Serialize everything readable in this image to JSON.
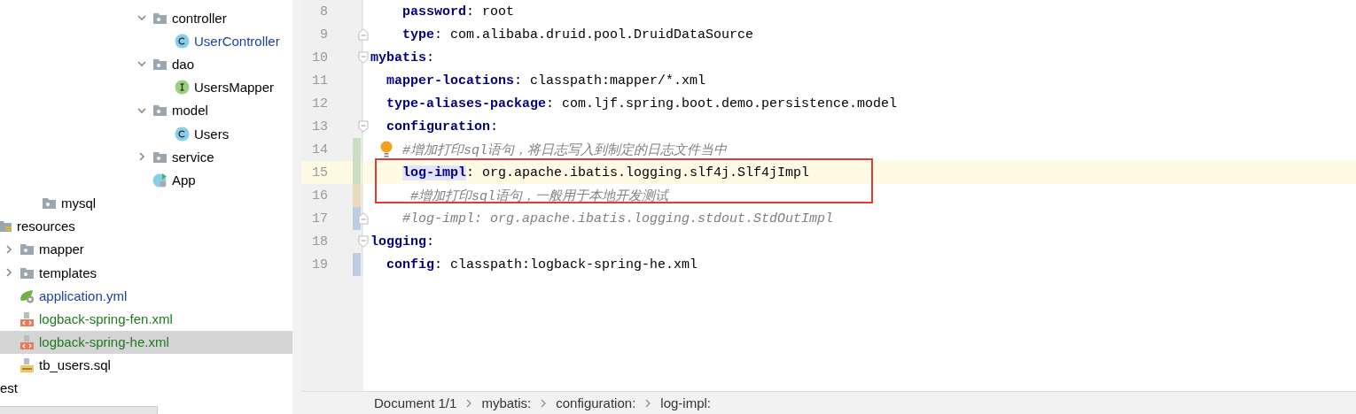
{
  "sidebar": {
    "package_items": [
      {
        "label": "controller",
        "kind": "folder",
        "expanded": true,
        "color": "#000000",
        "selected": false,
        "children": [
          {
            "label": "UserController",
            "kind": "class",
            "color": "#1e3fa8",
            "selected": false
          }
        ]
      },
      {
        "label": "dao",
        "kind": "folder",
        "expanded": true,
        "color": "#000000",
        "selected": false,
        "children": [
          {
            "label": "UsersMapper",
            "kind": "interface",
            "color": "#000000",
            "selected": false
          }
        ]
      },
      {
        "label": "model",
        "kind": "folder",
        "expanded": true,
        "color": "#000000",
        "selected": false,
        "children": [
          {
            "label": "Users",
            "kind": "class",
            "color": "#000000",
            "selected": false
          }
        ]
      },
      {
        "label": "service",
        "kind": "folder",
        "expanded": false,
        "color": "#000000",
        "selected": false
      },
      {
        "label": "App",
        "kind": "app",
        "color": "#000000",
        "selected": false
      }
    ],
    "mysql": {
      "label": "mysql",
      "kind": "folder",
      "color": "#000000",
      "selected": false
    },
    "resources": {
      "label": "resources",
      "kind": "resources",
      "color": "#000000",
      "selected": false,
      "children": [
        {
          "label": "mapper",
          "kind": "folder",
          "expanded": false,
          "color": "#000000",
          "selected": false
        },
        {
          "label": "templates",
          "kind": "folder",
          "expanded": false,
          "color": "#000000",
          "selected": false
        },
        {
          "label": "application.yml",
          "kind": "spring",
          "color": "#1e3fa8",
          "selected": false
        },
        {
          "label": "logback-spring-fen.xml",
          "kind": "xml",
          "color": "#1d7a1d",
          "selected": false
        },
        {
          "label": "logback-spring-he.xml",
          "kind": "xml",
          "color": "#1d7a1d",
          "selected": true
        },
        {
          "label": "tb_users.sql",
          "kind": "sql",
          "color": "#000000",
          "selected": false
        }
      ]
    },
    "test_label": "est"
  },
  "editor": {
    "continued_lines": [
      {
        "number": "8",
        "kind": "pair",
        "key": "password",
        "value": ": root"
      },
      {
        "number": "9",
        "kind": "pair",
        "key": "type",
        "value": ": com.alibaba.druid.pool.DruidDataSource",
        "fold_end": true
      }
    ],
    "lines": [
      {
        "number": "10",
        "kind": "pair",
        "key": "mybatis",
        "value": ":",
        "fold_start": true,
        "children": [
          {
            "number": "11",
            "kind": "pair",
            "key": "mapper-locations",
            "value": ": classpath:mapper/*.xml"
          },
          {
            "number": "12",
            "kind": "pair",
            "key": "type-aliases-package",
            "value": ": com.ljf.spring.boot.demo.persistence.model"
          },
          {
            "number": "13",
            "kind": "pair",
            "key": "configuration",
            "value": ":",
            "fold_start": true,
            "children": [
              {
                "number": "14",
                "kind": "comment",
                "text": "#增加打印sql语句，将日志写入到制定的日志文件当中",
                "color": "#c9dfc0",
                "intention": true
              },
              {
                "kind": "boxed",
                "children": [
                  {
                    "number": "15",
                    "kind": "pair",
                    "key": "log-impl",
                    "value": ": org.apache.ibatis.logging.slf4j.Slf4jImpl",
                    "color": "#c9dfc0",
                    "current": true
                  },
                  {
                    "number": "16",
                    "kind": "comment",
                    "text": " #增加打印sql语句，一般用于本地开发测试",
                    "color": "#eadbbd"
                  }
                ]
              },
              {
                "number": "17",
                "kind": "comment",
                "text": "#log-impl: org.apache.ibatis.logging.stdout.StdOutImpl",
                "color": "#bccde4",
                "fold_end": true
              }
            ]
          }
        ]
      },
      {
        "number": "18",
        "kind": "pair",
        "key": "logging",
        "value": ":",
        "fold_start": true,
        "children": [
          {
            "number": "19",
            "kind": "pair",
            "key": "config",
            "value": ": classpath:logback-spring-he.xml",
            "color": "#bccde4"
          }
        ]
      }
    ]
  },
  "breadcrumb": [
    "Document 1/1",
    "mybatis:",
    "configuration:",
    "log-impl:"
  ]
}
